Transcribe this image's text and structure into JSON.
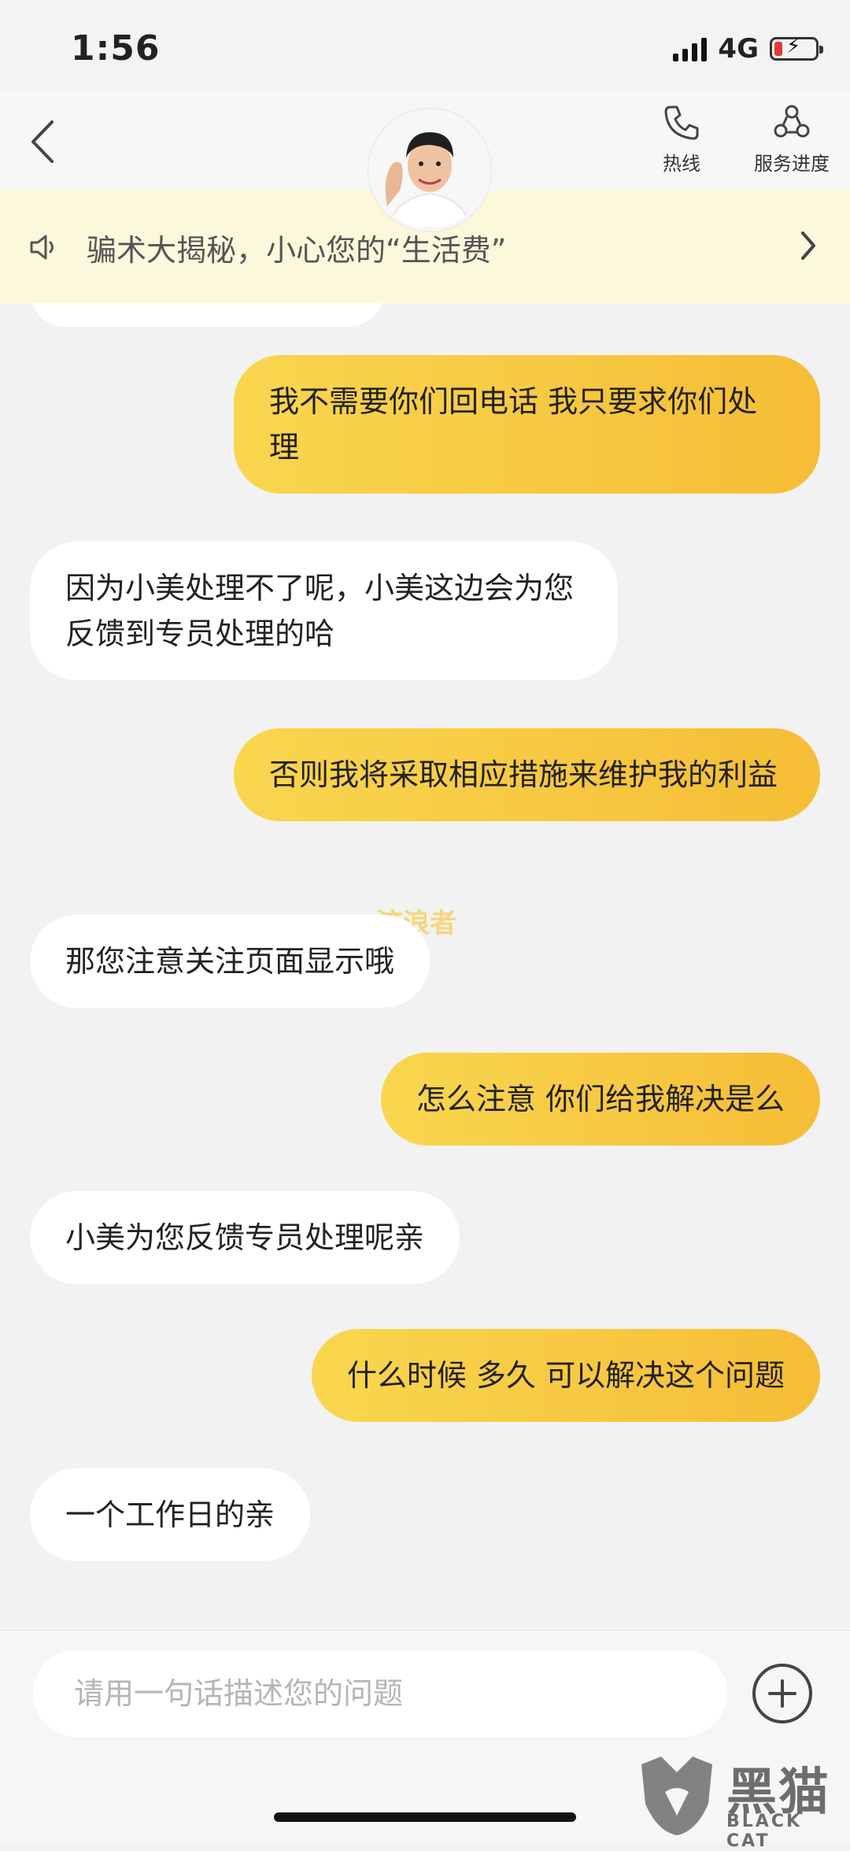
{
  "status": {
    "time": "1:56",
    "network": "4G"
  },
  "header": {
    "hotline_label": "热线",
    "progress_label": "服务进度"
  },
  "notice": {
    "text": "骗术大揭秘，小心您的“生活费”"
  },
  "chat": {
    "messages": [
      {
        "from": "user",
        "text": "我不需要你们回电话 我只要求你们处理"
      },
      {
        "from": "agent",
        "text": "因为小美处理不了呢，小美这边会为您反馈到专员处理的哈"
      },
      {
        "from": "user",
        "text": "否则我将采取相应措施来维护我的利益"
      },
      {
        "from": "agent",
        "text": "那您注意关注页面显示哦"
      },
      {
        "from": "user",
        "text": "怎么注意 你们给我解决是么"
      },
      {
        "from": "agent",
        "text": "小美为您反馈专员处理呢亲"
      },
      {
        "from": "user",
        "text": "什么时候 多久 可以解决这个问题"
      },
      {
        "from": "agent",
        "text": "一个工作日的亲"
      }
    ],
    "watermark": "流浪者"
  },
  "input": {
    "placeholder": "请用一句话描述您的问题"
  },
  "corner_logo": {
    "main": "黑猫",
    "sub": "BLACK CAT"
  },
  "colors": {
    "bubble_out_start": "#f9d64f",
    "bubble_out_end": "#f6bd36",
    "notice_bg": "#fcf8dc"
  }
}
